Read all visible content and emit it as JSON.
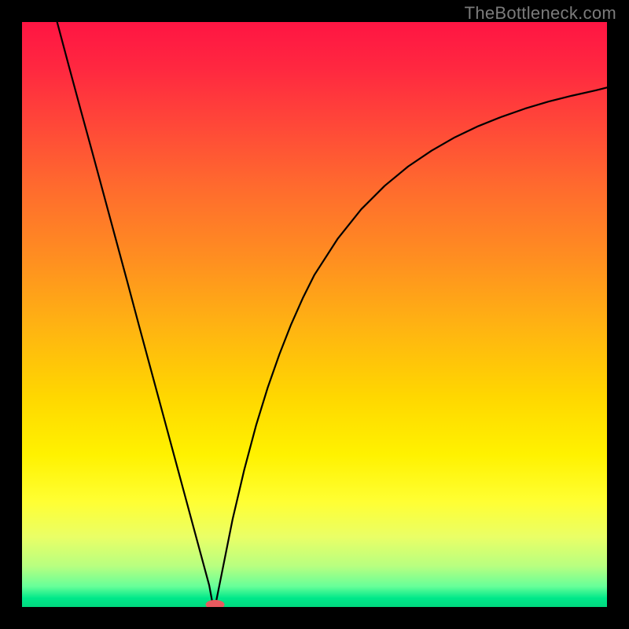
{
  "watermark": "TheBottleneck.com",
  "colors": {
    "frame_bg": "#000000",
    "watermark_text": "#7b7b7b",
    "curve_stroke": "#000000",
    "marker_fill": "#e75a5f",
    "gradient_stops": [
      {
        "offset": 0.0,
        "color": "#ff1543"
      },
      {
        "offset": 0.08,
        "color": "#ff2840"
      },
      {
        "offset": 0.18,
        "color": "#ff4938"
      },
      {
        "offset": 0.28,
        "color": "#ff6a2e"
      },
      {
        "offset": 0.4,
        "color": "#ff8d21"
      },
      {
        "offset": 0.52,
        "color": "#ffb312"
      },
      {
        "offset": 0.64,
        "color": "#ffd700"
      },
      {
        "offset": 0.74,
        "color": "#fff200"
      },
      {
        "offset": 0.82,
        "color": "#ffff33"
      },
      {
        "offset": 0.88,
        "color": "#eaff66"
      },
      {
        "offset": 0.93,
        "color": "#b8ff80"
      },
      {
        "offset": 0.965,
        "color": "#66ff99"
      },
      {
        "offset": 0.985,
        "color": "#00e88a"
      },
      {
        "offset": 1.0,
        "color": "#00d97e"
      }
    ]
  },
  "chart_data": {
    "type": "line",
    "title": "",
    "xlabel": "",
    "ylabel": "",
    "xlim": [
      0,
      100
    ],
    "ylim": [
      0,
      100
    ],
    "x": [
      6,
      8,
      10,
      12,
      14,
      16,
      18,
      20,
      22,
      24,
      26,
      28,
      30,
      31,
      32,
      32.5,
      33,
      34,
      36,
      38,
      40,
      42,
      44,
      46,
      48,
      50,
      54,
      58,
      62,
      66,
      70,
      74,
      78,
      82,
      86,
      90,
      94,
      98,
      100
    ],
    "values": [
      100.0,
      92.5,
      85.1,
      77.8,
      70.4,
      63.0,
      55.6,
      48.1,
      40.7,
      33.3,
      25.9,
      18.5,
      11.1,
      7.4,
      3.7,
      1.0,
      0.0,
      5.0,
      15.0,
      23.5,
      31.0,
      37.5,
      43.2,
      48.3,
      52.8,
      56.8,
      63.0,
      68.0,
      72.0,
      75.3,
      78.0,
      80.3,
      82.2,
      83.8,
      85.2,
      86.4,
      87.4,
      88.3,
      88.8
    ],
    "marker": {
      "x": 33,
      "y": 0
    },
    "annotations": []
  }
}
